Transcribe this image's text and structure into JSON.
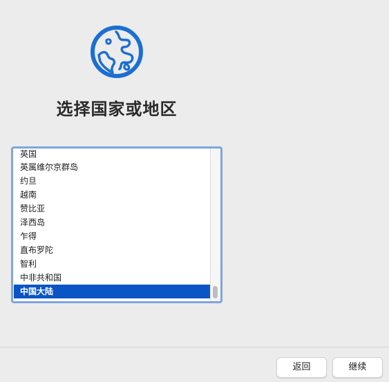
{
  "theme": {
    "accent": "#1b6fd1",
    "selection": "#0b54c5",
    "list_border": "#7fa4e0"
  },
  "header": {
    "icon": "globe-icon",
    "title": "选择国家或地区"
  },
  "country_list": {
    "items": [
      "英国",
      "英属维尔京群岛",
      "约旦",
      "越南",
      "赞比亚",
      "泽西岛",
      "乍得",
      "直布罗陀",
      "智利",
      "中非共和国",
      "中国大陆"
    ],
    "selected": "中国大陆"
  },
  "footer": {
    "back_label": "返回",
    "continue_label": "继续"
  }
}
